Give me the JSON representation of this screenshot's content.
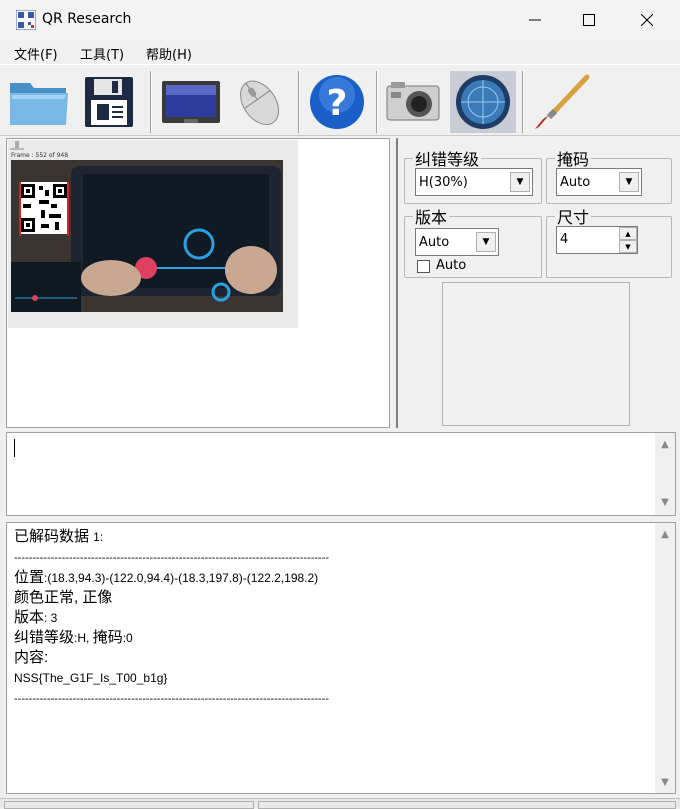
{
  "window": {
    "title": "QR Research",
    "controls": {
      "minimize": "—",
      "maximize": "☐",
      "close": "✕"
    }
  },
  "menu": {
    "file": "文件(F)",
    "tools": "工具(T)",
    "help": "帮助(H)"
  },
  "toolbar": {
    "buttons": [
      "open-folder-icon",
      "save-icon",
      "screen-capture-icon",
      "mouse-icon",
      "help-icon",
      "camera-icon",
      "scan-icon",
      "brush-icon"
    ]
  },
  "preview": {
    "frame_label": "Frame : 552 of 948"
  },
  "settings": {
    "ecc": {
      "label": "纠错等级",
      "value": "H(30%)"
    },
    "mask": {
      "label": "掩码",
      "value": "Auto"
    },
    "version": {
      "label": "版本",
      "value": "Auto",
      "checkbox_label": "Auto"
    },
    "size": {
      "label": "尺寸",
      "value": "4"
    }
  },
  "input": {
    "value": ""
  },
  "output": {
    "line1_cn": "已解码数据 ",
    "line1_num": "1:",
    "divider": "--------------------------------------------------------------------------------------",
    "pos_label": "位置",
    "pos_value": ":(18.3,94.3)-(122.0,94.4)-(18.3,197.8)-(122.2,198.2)",
    "color_line": "颜色正常, 正像",
    "version_label": "版本",
    "version_value": ": 3",
    "ecc_label": "纠错等级",
    "ecc_value": ":H, ",
    "mask_label": "掩码",
    "mask_value": ":0",
    "content_label": "内容:",
    "content_value": "NSS{The_G1F_Is_T00_b1g}",
    "divider2": "--------------------------------------------------------------------------------------"
  }
}
